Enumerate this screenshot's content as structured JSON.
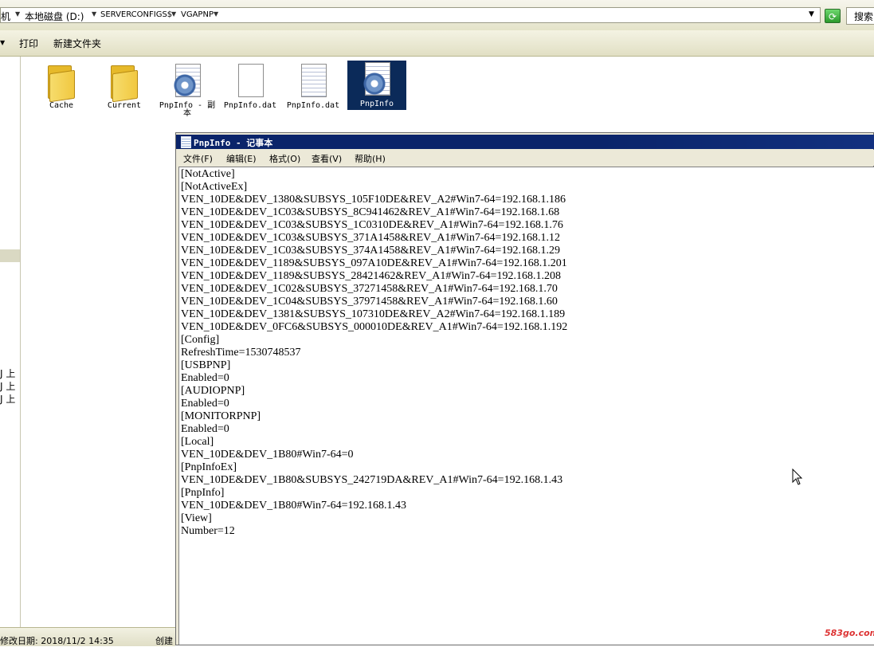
{
  "address": {
    "crumbs": [
      "机",
      "本地磁盘 (D:)",
      "SERVERCONFIGS$",
      "VGAPNP"
    ]
  },
  "search": {
    "label": "搜索"
  },
  "toolbar": {
    "print_label": "打印",
    "new_folder_label": "新建文件夹"
  },
  "nav": {
    "fragments": [
      "J 上",
      "J 上",
      "J 上"
    ]
  },
  "files": [
    {
      "name": "Cache",
      "icon": "folder-icon",
      "selected": false
    },
    {
      "name": "Current",
      "icon": "folder-icon",
      "selected": false
    },
    {
      "name": "PnpInfo - 副本",
      "icon": "config-file-icon",
      "selected": false
    },
    {
      "name": "PnpInfo.dat",
      "icon": "blank-file-icon",
      "selected": false
    },
    {
      "name": "PnpInfo.dat",
      "icon": "text-file-icon",
      "selected": false
    },
    {
      "name": "PnpInfo",
      "icon": "config-file-icon",
      "selected": true
    }
  ],
  "status": {
    "modified": "修改日期: 2018/11/2 14:35",
    "created_label": "创建"
  },
  "notepad": {
    "title": "PnpInfo - 记事本",
    "menu": [
      "文件(F)",
      "编辑(E)",
      "格式(O)",
      "查看(V)",
      "帮助(H)"
    ],
    "lines": [
      "[NotActive]",
      "[NotActiveEx]",
      "VEN_10DE&DEV_1380&SUBSYS_105F10DE&REV_A2#Win7-64=192.168.1.186",
      "VEN_10DE&DEV_1C03&SUBSYS_8C941462&REV_A1#Win7-64=192.168.1.68",
      "VEN_10DE&DEV_1C03&SUBSYS_1C0310DE&REV_A1#Win7-64=192.168.1.76",
      "VEN_10DE&DEV_1C03&SUBSYS_371A1458&REV_A1#Win7-64=192.168.1.12",
      "VEN_10DE&DEV_1C03&SUBSYS_374A1458&REV_A1#Win7-64=192.168.1.29",
      "VEN_10DE&DEV_1189&SUBSYS_097A10DE&REV_A1#Win7-64=192.168.1.201",
      "VEN_10DE&DEV_1189&SUBSYS_28421462&REV_A1#Win7-64=192.168.1.208",
      "VEN_10DE&DEV_1C02&SUBSYS_37271458&REV_A1#Win7-64=192.168.1.70",
      "VEN_10DE&DEV_1C04&SUBSYS_37971458&REV_A1#Win7-64=192.168.1.60",
      "VEN_10DE&DEV_1381&SUBSYS_107310DE&REV_A2#Win7-64=192.168.1.189",
      "VEN_10DE&DEV_0FC6&SUBSYS_000010DE&REV_A1#Win7-64=192.168.1.192",
      "[Config]",
      "RefreshTime=1530748537",
      "[USBPNP]",
      "Enabled=0",
      "[AUDIOPNP]",
      "Enabled=0",
      "[MONITORPNP]",
      "Enabled=0",
      "[Local]",
      "VEN_10DE&DEV_1B80#Win7-64=0",
      "[PnpInfoEx]",
      "VEN_10DE&DEV_1B80&SUBSYS_242719DA&REV_A1#Win7-64=192.168.1.43",
      "[PnpInfo]",
      "VEN_10DE&DEV_1B80#Win7-64=192.168.1.43",
      "[View]",
      "Number=12"
    ]
  },
  "watermark": "583go.com"
}
